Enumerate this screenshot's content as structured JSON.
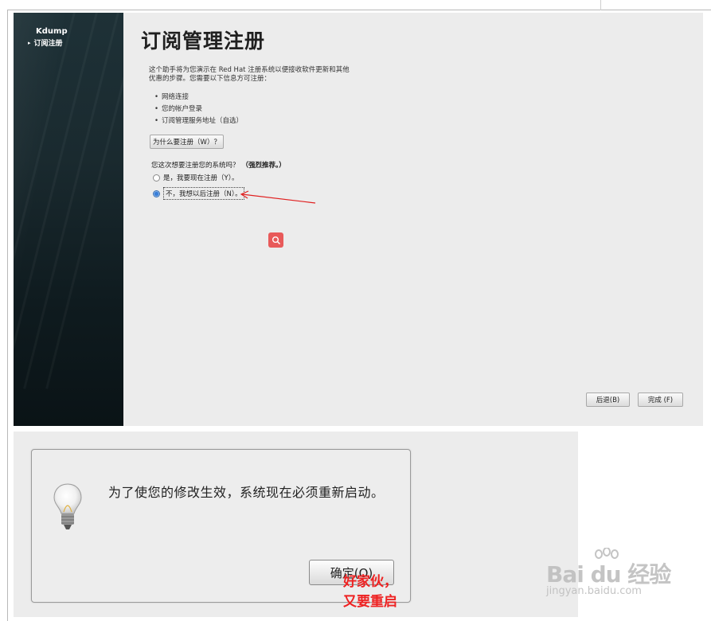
{
  "installer": {
    "sidebar": {
      "app_name": "Kdump",
      "current_item": "订阅注册"
    },
    "title": "订阅管理注册",
    "intro": "这个助手将为您演示在 Red Hat 注册系统以便接收软件更新和其他优惠的步骤。您需要以下信息方可注册：",
    "requirements": [
      "网络连接",
      "您的帐户登录",
      "订阅管理服务地址（自选）"
    ],
    "why_button": "为什么要注册（W）？",
    "question": "您这次想要注册您的系统吗？",
    "recommendation": "（强烈推荐。）",
    "options": [
      {
        "label": "是，我要现在注册（Y）。",
        "selected": false
      },
      {
        "label": "不，我想以后注册（N）。",
        "selected": true
      }
    ],
    "back_button": "后退(B)",
    "finish_button": "完成 (F)"
  },
  "reboot_dialog": {
    "message": "为了使您的修改生效，系统现在必须重新启动。",
    "ok_button": "确定(O)",
    "annotation": "好家伙，又要重启"
  },
  "watermark": {
    "brand": "Bai du 经验",
    "url": "jingyan.baidu.com"
  },
  "colors": {
    "sidebar_bg": "#1a2a2f",
    "window_bg": "#ececec",
    "annotation_red": "#ee2222",
    "search_badge": "#e85a5a"
  }
}
